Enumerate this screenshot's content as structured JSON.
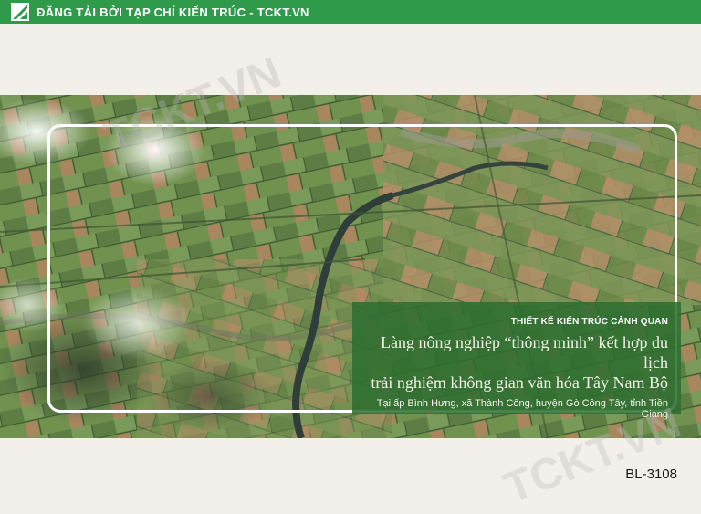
{
  "header": {
    "banner_text": "ĐĂNG TẢI BỞI TẠP CHÍ KIẾN TRÚC - TCKT.VN",
    "logo_icon": "tckt-logo-icon",
    "color": "#2f9a4a"
  },
  "panel": {
    "category": "THIẾT KẾ KIẾN TRÚC CẢNH QUAN",
    "title_line1": "Làng nông nghiệp “thông minh” kết hợp du lịch",
    "title_line2": "trải nghiệm không gian văn hóa Tây Nam Bộ",
    "location": "Tại ấp Bình Hưng, xã Thành Công, huyện Gò Công Tây, tỉnh Tiền Giang",
    "color": "#2c6e30"
  },
  "watermark": {
    "text_top": "TCKT.VN",
    "text_bottom": "TCKT.VN"
  },
  "footer": {
    "code": "BL-3108"
  }
}
